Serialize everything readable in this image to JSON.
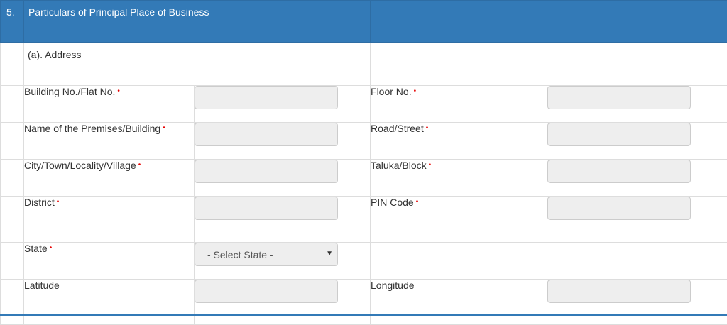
{
  "section": {
    "number": "5.",
    "title": "Particulars of Principal Place of Business"
  },
  "subsection": {
    "label": "(a). Address"
  },
  "required_marker": "•",
  "fields": {
    "building_no": {
      "label": "Building No./Flat No.",
      "value": ""
    },
    "floor_no": {
      "label": "Floor No.",
      "value": ""
    },
    "premises": {
      "label": "Name of the Premises/Building",
      "value": ""
    },
    "road": {
      "label": "Road/Street",
      "value": ""
    },
    "city": {
      "label": "City/Town/Locality/Village",
      "value": ""
    },
    "taluka": {
      "label": "Taluka/Block",
      "value": ""
    },
    "district": {
      "label": "District",
      "value": ""
    },
    "pin": {
      "label": "PIN Code",
      "value": ""
    },
    "state": {
      "label": "State",
      "selected": "- Select State -"
    },
    "latitude": {
      "label": "Latitude",
      "value": ""
    },
    "longitude": {
      "label": "Longitude",
      "value": ""
    }
  },
  "colors": {
    "header_bg": "#337ab7",
    "required": "#e60000",
    "input_bg": "#eeeeee"
  }
}
